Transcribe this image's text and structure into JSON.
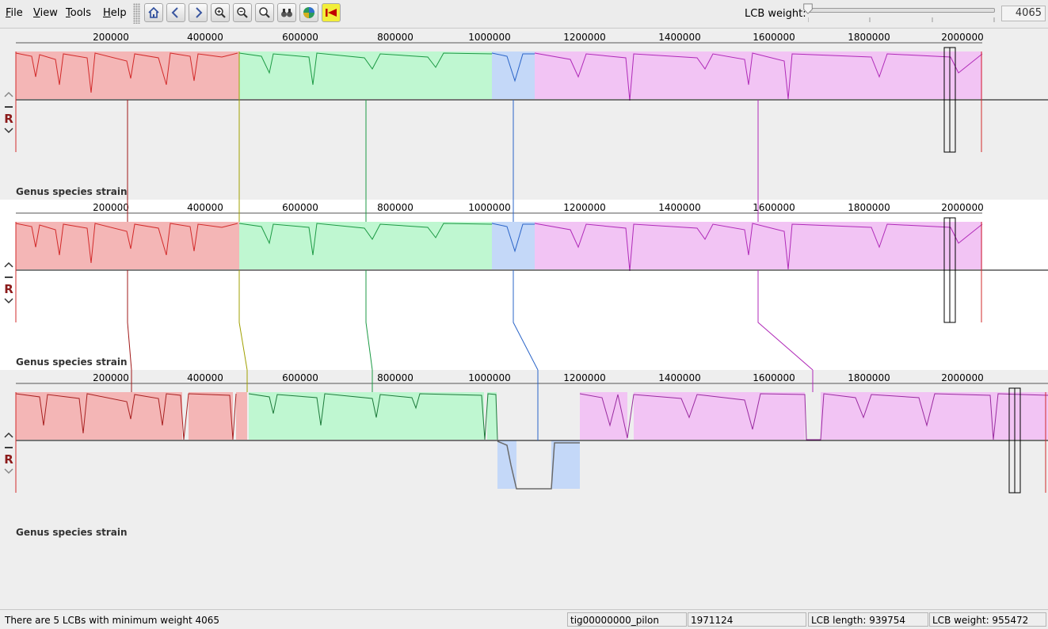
{
  "menu": [
    "File",
    "View",
    "Tools",
    "Help"
  ],
  "toolbar_icons": [
    "home-icon",
    "prev-icon",
    "next-icon",
    "zoom-in-icon",
    "zoom-out-icon",
    "zoom-reset-icon",
    "binoculars-icon",
    "color-wheel-icon",
    "back-arrow-icon"
  ],
  "lcb_weight": {
    "label": "LCB weight:",
    "value": "4065",
    "slider_fraction": 0.0
  },
  "ticks": [
    "200000",
    "400000",
    "600000",
    "800000",
    "1000000",
    "1200000",
    "1400000",
    "1600000",
    "1800000",
    "2000000"
  ],
  "genomes": [
    {
      "name": "Genus species strain",
      "reverse_label": "R"
    },
    {
      "name": "Genus species strain",
      "reverse_label": "R"
    },
    {
      "name": "Genus species strain",
      "reverse_label": "R"
    }
  ],
  "colors": {
    "red": "#f4b6b6",
    "green": "#bff7d1",
    "blue": "#c4d8f8",
    "magenta": "#f2c4f4",
    "red_line": "#d22a2a",
    "green_line": "#1c9a44",
    "blue_line": "#2a64c8",
    "magenta_line": "#b02ab8",
    "yellow_line": "#a0a000"
  },
  "status": {
    "message": "There are 5 LCBs with minimum weight 4065",
    "contig": "tig00000000_pilon",
    "position": "1971124",
    "lcb_length": "LCB length: 939754",
    "lcb_weight": "LCB weight: 955472"
  }
}
